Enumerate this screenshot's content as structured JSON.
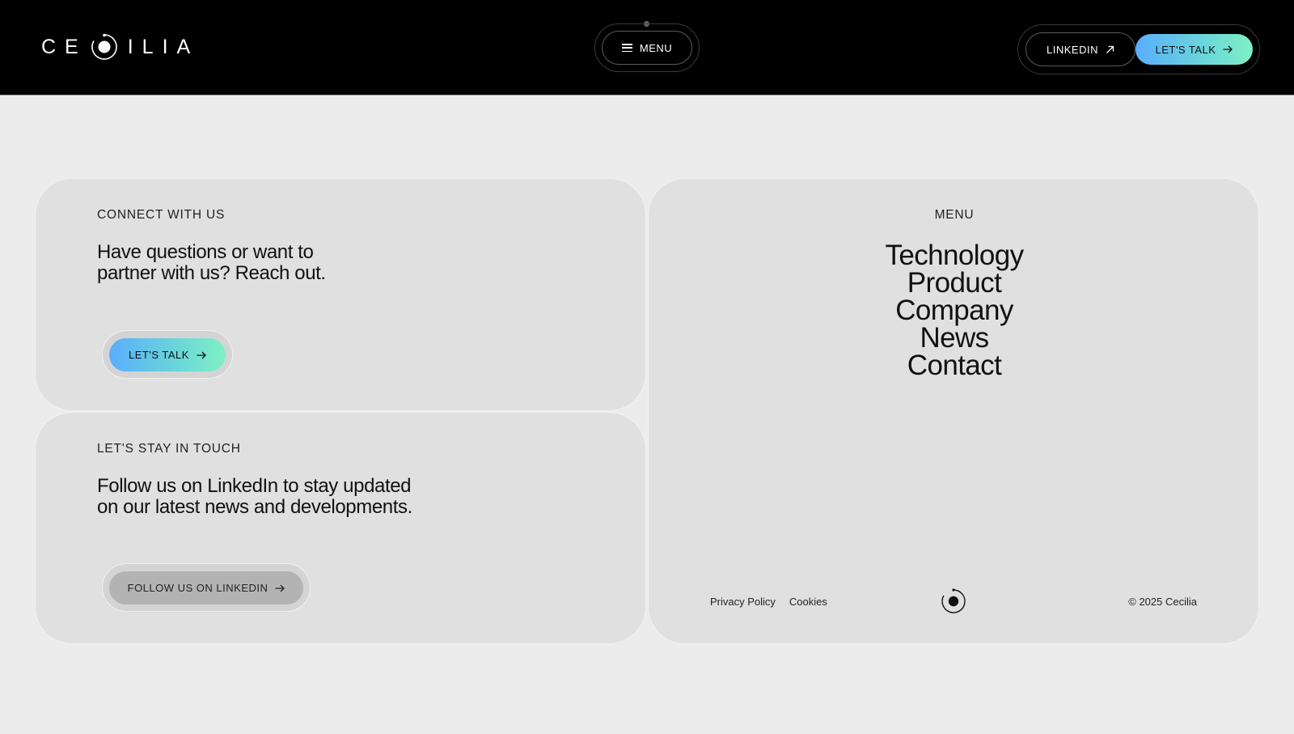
{
  "header": {
    "logo_left": "CE",
    "logo_right": "ILIA",
    "menu_label": "MENU",
    "linkedin_label": "LINKEDIN",
    "talk_label": "LET'S TALK"
  },
  "connect": {
    "eyebrow": "CONNECT WITH US",
    "line1": "Have questions or want to",
    "line2": "partner with us? Reach out.",
    "button_label": "LET'S TALK"
  },
  "touch": {
    "eyebrow": "LET'S STAY IN TOUCH",
    "line1": "Follow us on LinkedIn to stay updated",
    "line2": "on our latest news and developments.",
    "button_label": "FOLLOW US ON LINKEDIN"
  },
  "menu": {
    "title": "MENU",
    "items": [
      "Technology",
      "Product",
      "Company",
      "News",
      "Contact"
    ]
  },
  "footer": {
    "privacy": "Privacy Policy",
    "cookies": "Cookies",
    "copyright": "© 2025 Cecilia"
  },
  "colors": {
    "header_bg": "#000000",
    "page_bg": "#ececec",
    "card_bg": "#e0e0e0",
    "gradient_start": "#5aaefc",
    "gradient_end": "#7ff0c4"
  },
  "icons": {
    "logo_mark": "orbit-circle-icon",
    "menu": "hamburger-icon",
    "linkedin": "arrow-up-right-icon",
    "talk": "arrow-right-icon"
  }
}
